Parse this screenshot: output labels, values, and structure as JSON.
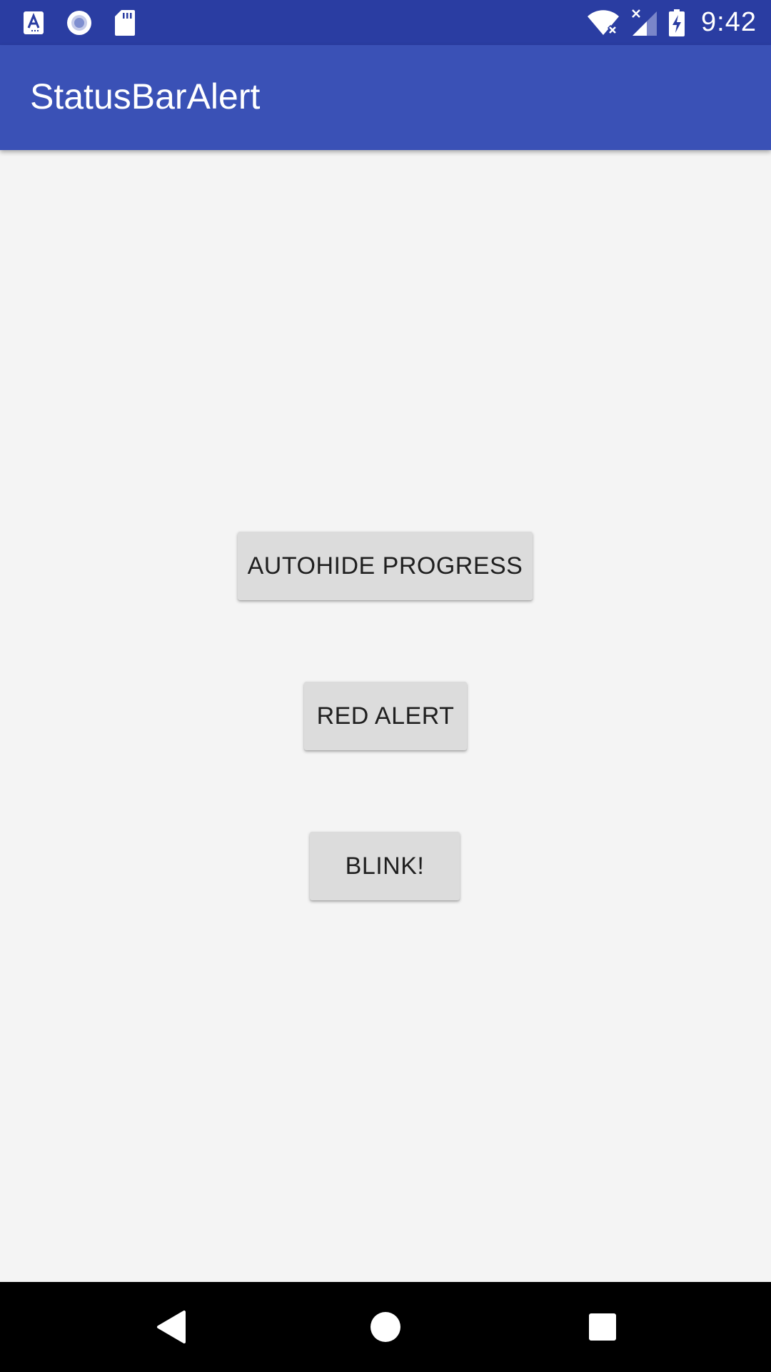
{
  "status_bar": {
    "time": "9:42",
    "left_icons": [
      "a-notification-icon",
      "record-notification-icon",
      "sd-card-icon"
    ],
    "right_icons": [
      "wifi-no-internet-icon",
      "cellular-no-signal-icon",
      "battery-charging-icon"
    ]
  },
  "app_bar": {
    "title": "StatusBarAlert"
  },
  "main": {
    "buttons": [
      {
        "label": "AUTOHIDE PROGRESS"
      },
      {
        "label": "RED ALERT"
      },
      {
        "label": "BLINK!"
      }
    ]
  },
  "nav_bar": {
    "icons": [
      "back-icon",
      "home-icon",
      "recents-icon"
    ]
  },
  "colors": {
    "status_bar": "#2a3da2",
    "app_bar": "#3a51b6",
    "background": "#f4f4f4",
    "button": "#dcdcdc",
    "button_text": "#1f1f1f"
  }
}
